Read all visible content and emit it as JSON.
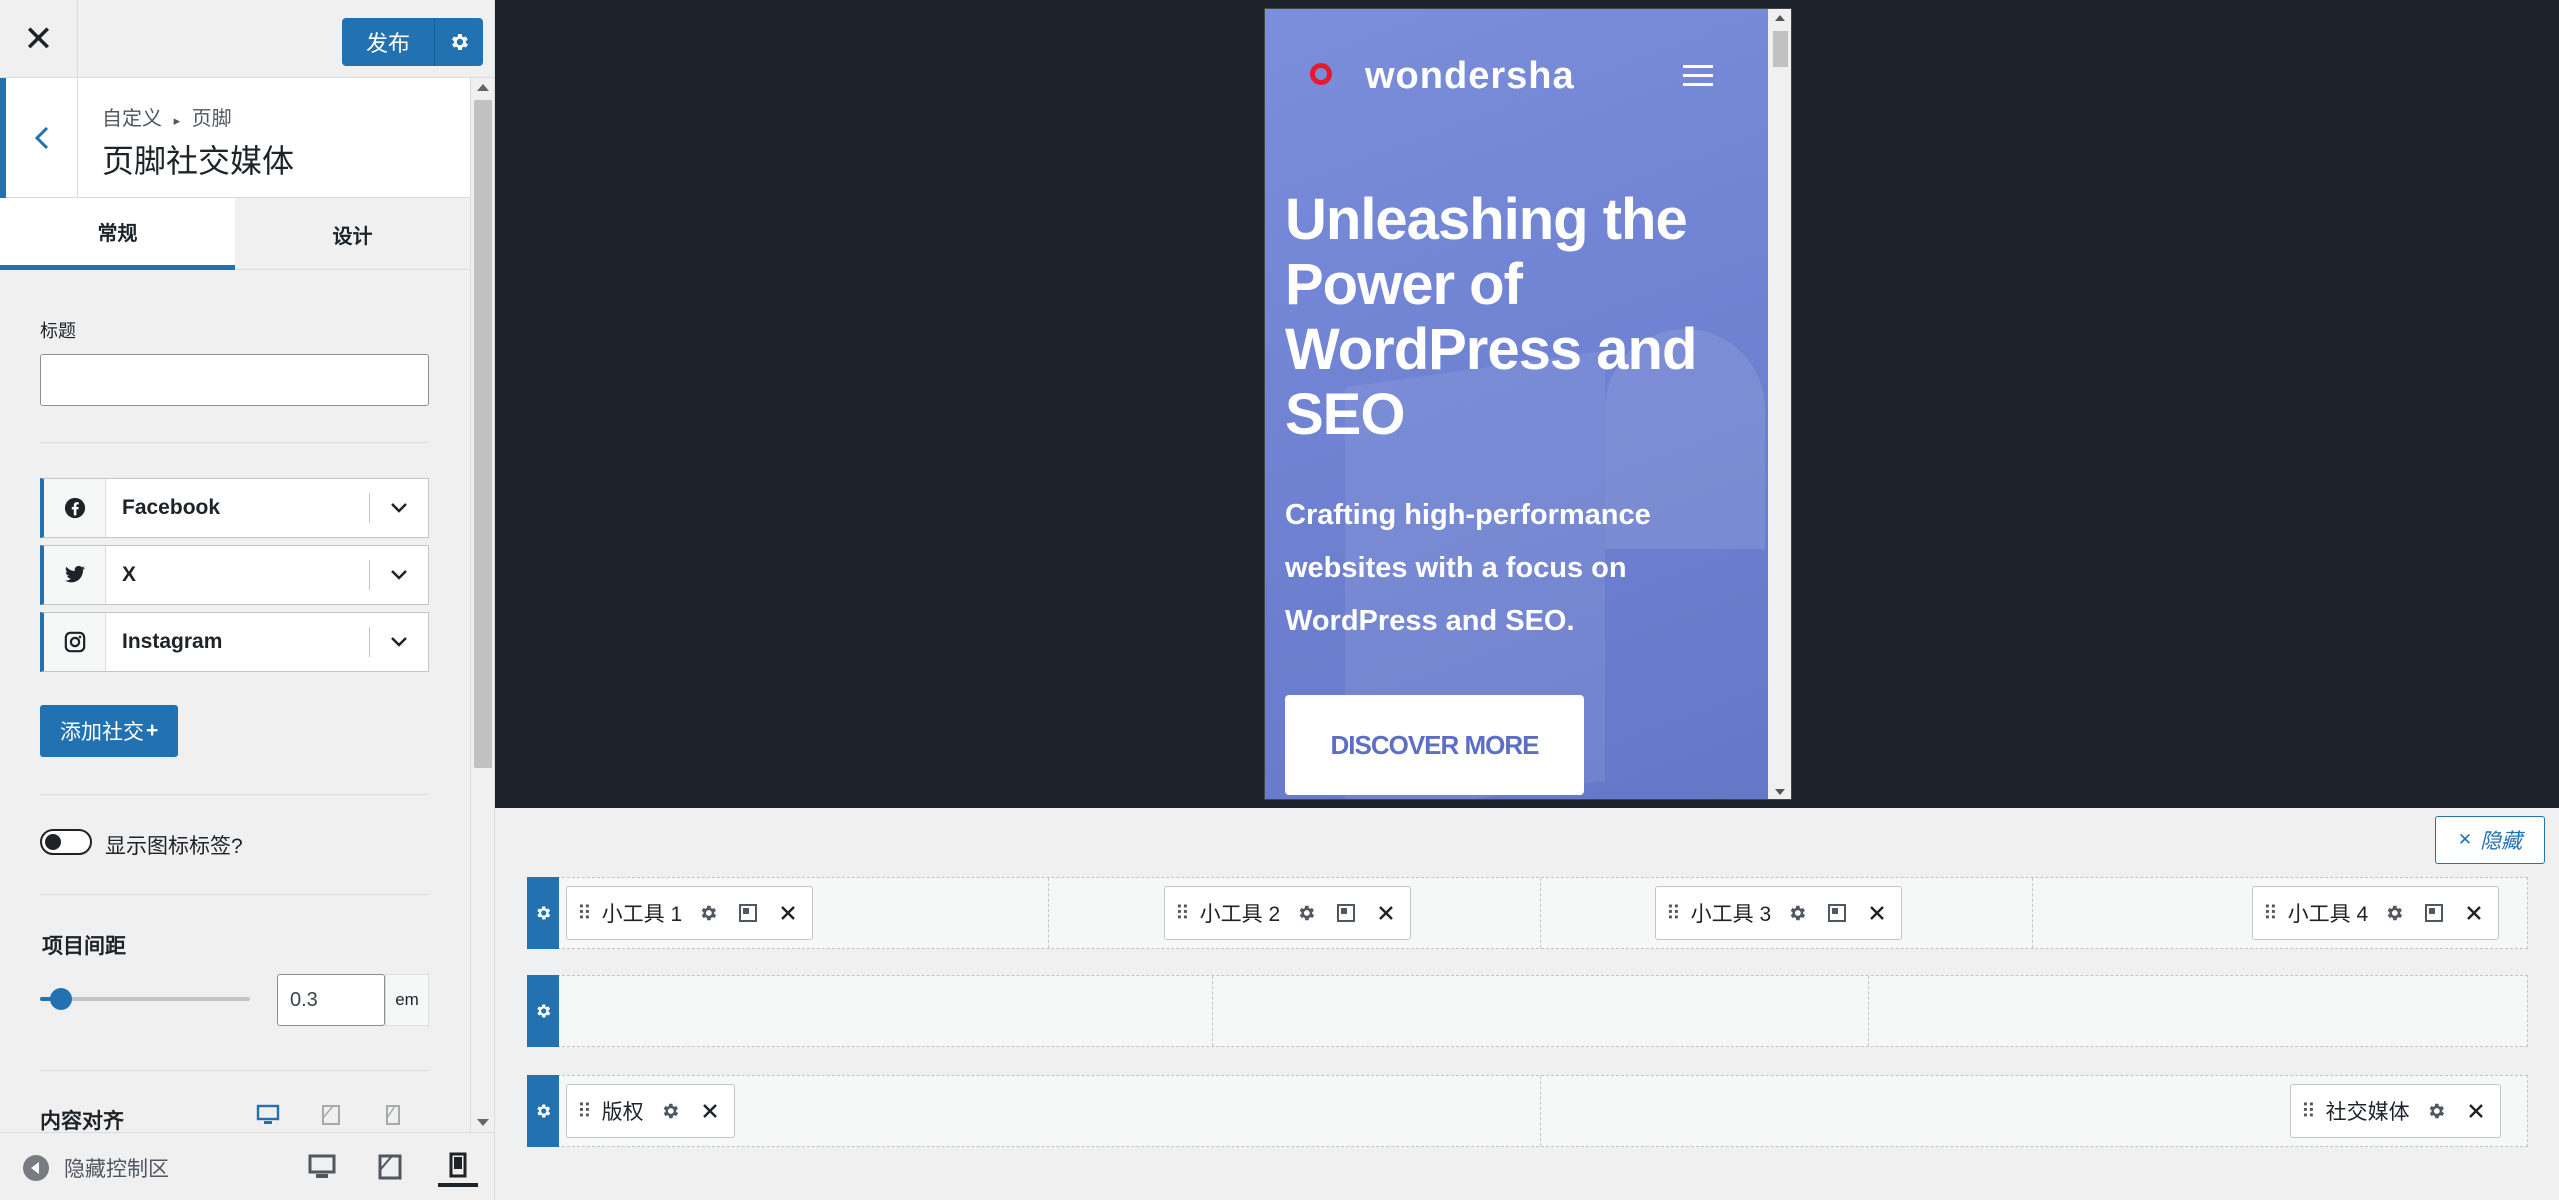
{
  "sidebar": {
    "close_icon": "✕",
    "publish_label": "发布",
    "breadcrumb_root": "自定义",
    "breadcrumb_sep": "▸",
    "breadcrumb_parent": "页脚",
    "section_title": "页脚社交媒体",
    "tabs": [
      {
        "label": "常规",
        "active": true
      },
      {
        "label": "设计",
        "active": false
      }
    ],
    "title_field_label": "标题",
    "title_field_value": "",
    "social_items": [
      {
        "name": "Facebook",
        "icon": "facebook-icon"
      },
      {
        "name": "X",
        "icon": "twitter-icon"
      },
      {
        "name": "Instagram",
        "icon": "instagram-icon"
      }
    ],
    "add_social_label": "添加社交",
    "add_social_plus": "+",
    "show_labels_toggle": "显示图标标签?",
    "show_labels_on": false,
    "item_spacing_label": "项目间距",
    "item_spacing_value": "0.3",
    "item_spacing_unit": "em",
    "item_spacing_fraction": 0.1,
    "content_align_label": "内容对齐",
    "hide_controls_label": "隐藏控制区",
    "active_device": "mobile"
  },
  "preview": {
    "site_name": "wondersha",
    "hero_title": "Unleashing the Power of WordPress and SEO",
    "hero_subtitle": "Crafting high-performance websites with a focus on WordPress and SEO.",
    "cta_label": "DISCOVER MORE",
    "accent_color": "#6f83d4",
    "logo_color": "#e8192c"
  },
  "builder": {
    "hide_label": "隐藏",
    "hide_icon": "✕",
    "rows": [
      {
        "widgets": [
          {
            "label": "小工具 1"
          },
          {
            "label": "小工具 2"
          },
          {
            "label": "小工具 3"
          },
          {
            "label": "小工具 4"
          }
        ]
      },
      {
        "widgets": []
      },
      {
        "widgets": [
          {
            "label": "版权"
          },
          {
            "label": "社交媒体"
          }
        ]
      }
    ],
    "brand_color": "#2271b1"
  }
}
